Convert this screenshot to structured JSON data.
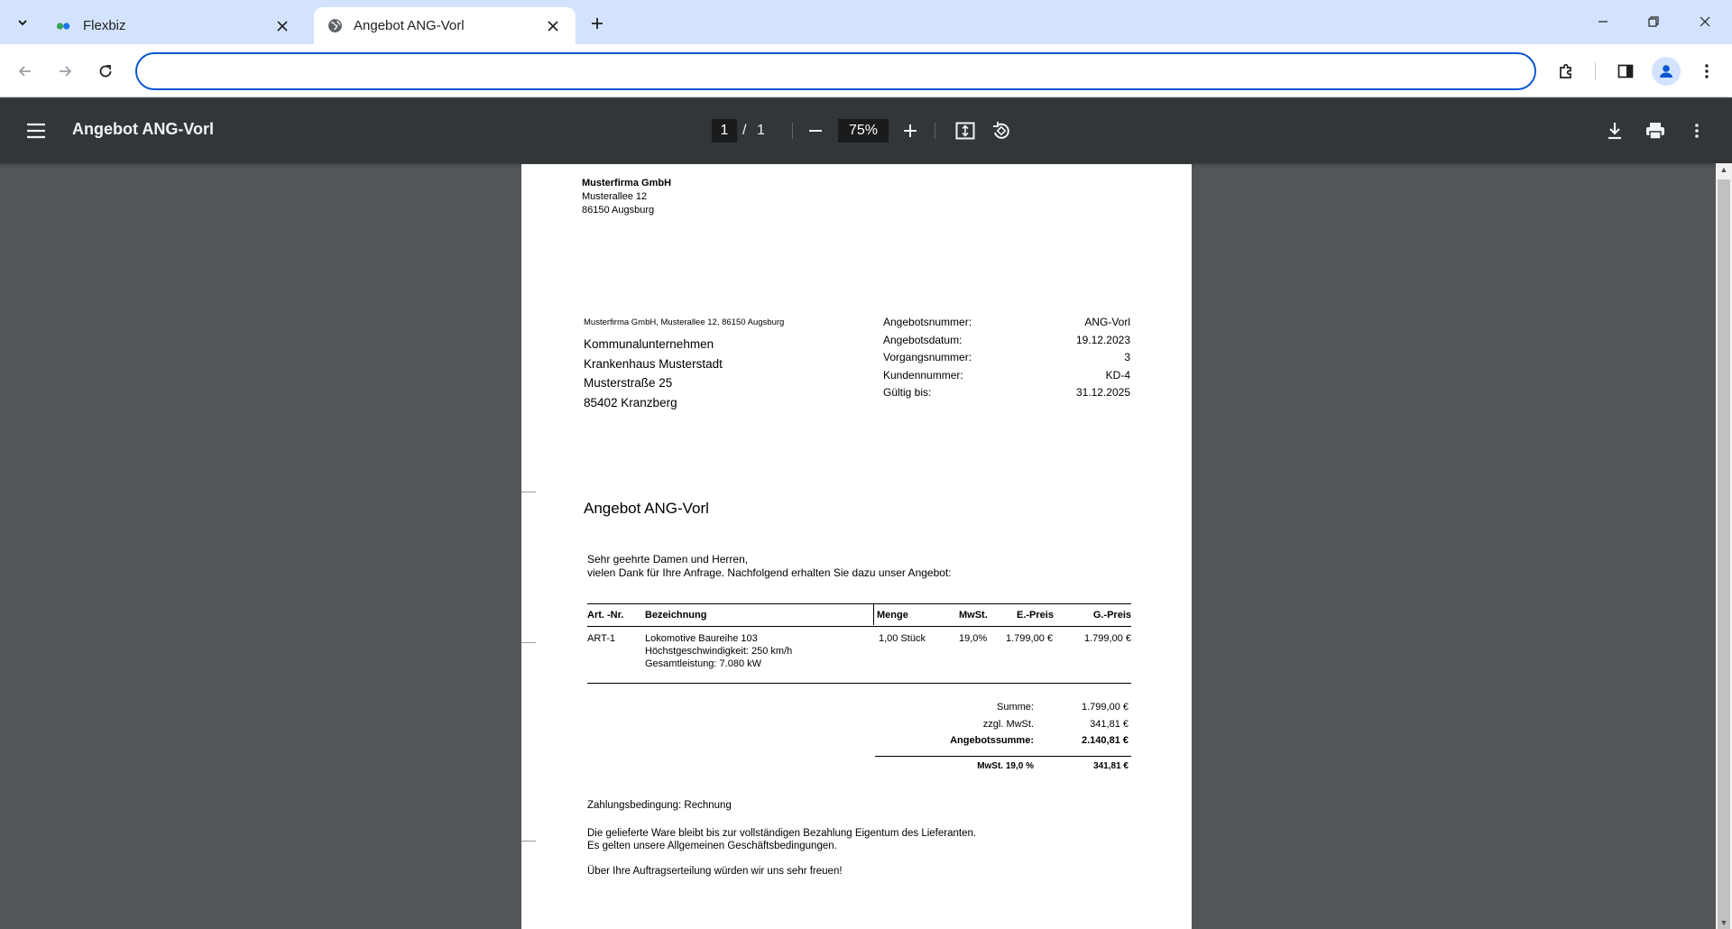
{
  "browser": {
    "tabs": [
      {
        "title": "Flexbiz",
        "active": false
      },
      {
        "title": "Angebot ANG-Vorl",
        "active": true
      }
    ],
    "address": {
      "value": "",
      "placeholder": ""
    }
  },
  "viewer": {
    "title": "Angebot ANG-Vorl",
    "page_current": "1",
    "page_separator": "/",
    "page_total": "1",
    "zoom": "75%"
  },
  "document": {
    "sender": {
      "name": "Musterfirma GmbH",
      "street": "Musterallee 12",
      "city": "86150 Augsburg"
    },
    "return_address": "Musterfirma GmbH, Musterallee 12, 86150 Augsburg",
    "recipient": [
      "Kommunalunternehmen",
      "Krankenhaus Musterstadt",
      "Musterstraße 25",
      "85402 Kranzberg"
    ],
    "meta": [
      {
        "label": "Angebotsnummer:",
        "value": "ANG-Vorl"
      },
      {
        "label": "Angebotsdatum:",
        "value": "19.12.2023"
      },
      {
        "label": "Vorgangsnummer:",
        "value": "3"
      },
      {
        "label": "Kundennummer:",
        "value": "KD-4"
      },
      {
        "label": "Gültig bis:",
        "value": "31.12.2025"
      }
    ],
    "subject": "Angebot ANG-Vorl",
    "intro": [
      "Sehr geehrte Damen und Herren,",
      "vielen Dank für Ihre Anfrage. Nachfolgend erhalten Sie dazu unser Angebot:"
    ],
    "table": {
      "headers": {
        "art": "Art. -Nr.",
        "bez": "Bezeichnung",
        "menge": "Menge",
        "mwst": "MwSt.",
        "epreis": "E.-Preis",
        "gpreis": "G.-Preis"
      },
      "rows": [
        {
          "art": "ART-1",
          "bez": "Lokomotive Baureihe 103",
          "details": [
            "Höchstgeschwindigkeit: 250 km/h",
            "Gesamtleistung: 7.080 kW"
          ],
          "menge": "1,00 Stück",
          "mwst": "19,0%",
          "epreis": "1.799,00 €",
          "gpreis": "1.799,00 €"
        }
      ]
    },
    "totals": {
      "summe_label": "Summe:",
      "summe": "1.799,00 €",
      "mwst_label": "zzgl. MwSt.",
      "mwst": "341,81 €",
      "gesamt_label": "Angebotssumme:",
      "gesamt": "2.140,81 €",
      "breakdown_label": "MwSt. 19,0 %",
      "breakdown": "341,81 €"
    },
    "payment": "Zahlungsbedingung: Rechnung",
    "notes": [
      "Die gelieferte Ware bleibt bis zur vollständigen Bezahlung Eigentum des Lieferanten.",
      "Es gelten unsere Allgemeinen Geschäftsbedingungen."
    ],
    "closing": "Über Ihre Auftragserteilung würden wir uns sehr freuen!"
  }
}
